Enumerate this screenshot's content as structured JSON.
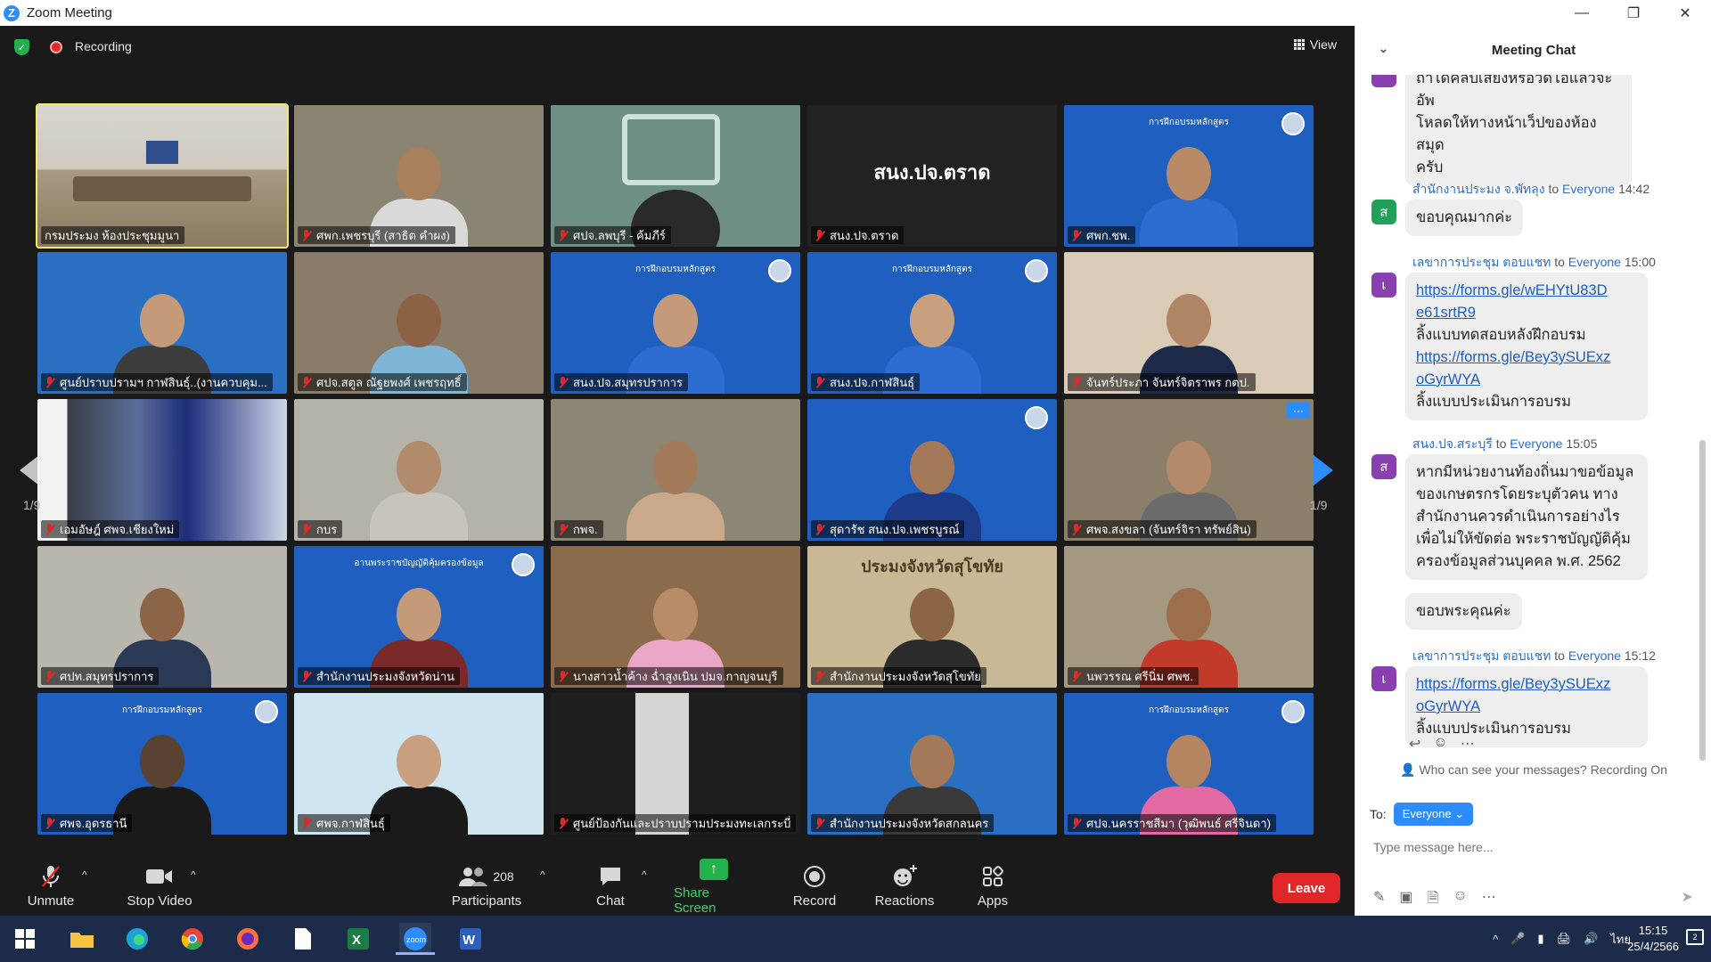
{
  "window": {
    "title": "Zoom Meeting",
    "controls": [
      "—",
      "❐",
      "✕"
    ]
  },
  "top": {
    "recording_label": "Recording",
    "view_label": "View"
  },
  "pagination": {
    "left": "1/9",
    "right": "1/9"
  },
  "tiles": [
    {
      "name": "กรมประมง ห้องประชุมมูนา",
      "muted": false,
      "bg": "#bfb7a5",
      "active": true,
      "kind": "room"
    },
    {
      "name": "ศพก.เพชรบุรี (สาธิต คำผง)",
      "muted": true,
      "bg": "#8a8572",
      "kind": "person",
      "skin": "#a9805c",
      "shirt": "#d9d9d9"
    },
    {
      "name": "ศปจ.ลพบุรี - ค้มภีร์",
      "muted": true,
      "bg": "#6f8e86",
      "kind": "logo"
    },
    {
      "name": "สนง.ปจ.ตราด",
      "muted": true,
      "bg": "#222222",
      "kind": "text",
      "big_text": "สนง.ปจ.ตราด"
    },
    {
      "name": "ศพก.ชพ.",
      "muted": true,
      "bg": "#1f5fbf",
      "kind": "banner",
      "banner": "การฝึกอบรมหลักสูตร",
      "skin": "#b98a66",
      "shirt": "#2d6cd0"
    },
    {
      "name": "ศูนย์ปราบปรามฯ กาฬสินธุ์..(งานควบคุม...",
      "muted": true,
      "bg": "#2a6fc2",
      "kind": "person",
      "skin": "#c59a78",
      "shirt": "#3d3d3d"
    },
    {
      "name": "ศปจ.สตูล ณัฐยพงศ์ เพชรฤทธิ์",
      "muted": true,
      "bg": "#8a7c68",
      "kind": "person",
      "skin": "#8d6244",
      "shirt": "#7fb6d6"
    },
    {
      "name": "สนง.ปจ.สมุทรปราการ",
      "muted": true,
      "bg": "#1f5fbf",
      "kind": "banner",
      "banner": "การฝึกอบรมหลักสูตร",
      "skin": "#c49a7a",
      "shirt": "#2d6cd0"
    },
    {
      "name": "สนง.ปจ.กาฬสินธุ์",
      "muted": true,
      "bg": "#1f5fbf",
      "kind": "banner",
      "banner": "การฝึกอบรมหลักสูตร",
      "skin": "#c8a07e",
      "shirt": "#2d6cd0"
    },
    {
      "name": "จันทร์ประภา จันทร์จิตราพร กตป.",
      "muted": true,
      "bg": "#d9cbb5",
      "kind": "person",
      "skin": "#b08563",
      "shirt": "#1e2a4a"
    },
    {
      "name": "เอมอัษฎ์ ศพจ.เชียงใหม่",
      "muted": true,
      "bg": "#2b3f78",
      "kind": "blur"
    },
    {
      "name": "กบร",
      "muted": true,
      "bg": "#b5b2aa",
      "kind": "person",
      "skin": "#b18b6c",
      "shirt": "#c9c4bb"
    },
    {
      "name": "กพจ.",
      "muted": true,
      "bg": "#8c8676",
      "kind": "person",
      "skin": "#a37a5a",
      "shirt": "#c9a98a"
    },
    {
      "name": "สุดารัช สนง.ปจ.เพชรบูรณ์",
      "muted": true,
      "bg": "#1f5fbf",
      "kind": "banner",
      "banner": "",
      "skin": "#a4795a",
      "shirt": "#1c3b8a"
    },
    {
      "name": "ศพจ.สงขลา (จันทร์จิรา ทรัพย์สิน)",
      "muted": true,
      "bg": "#8c7f6a",
      "kind": "person",
      "skin": "#b38b6a",
      "shirt": "#6b6b6b",
      "more": true
    },
    {
      "name": "ศปท.สมุทรปราการ",
      "muted": true,
      "bg": "#b9b6ae",
      "kind": "person",
      "skin": "#8c6446",
      "shirt": "#2c3a55"
    },
    {
      "name": "สำนักงานประมงจังหวัดน่าน",
      "muted": true,
      "bg": "#1f5fbf",
      "kind": "banner",
      "banner": "อานพระราชบัญญัติคุ้มครองข้อมูล",
      "skin": "#c59a78",
      "shirt": "#7b2a2a"
    },
    {
      "name": "นางสาวน้ำค้าง ฉ่ำสูงเนิน ปมจ.กาญจนบุรี",
      "muted": true,
      "bg": "#8c6a4c",
      "kind": "person",
      "skin": "#b88c68",
      "shirt": "#e9a6c6"
    },
    {
      "name": "สำนักงานประมงจังหวัดสุโขทัย",
      "muted": true,
      "bg": "#c9b895",
      "kind": "person",
      "skin": "#8c6446",
      "shirt": "#2c2c2c",
      "big_text": "ประมงจังหวัดสุโขทัย"
    },
    {
      "name": "นพวรรณ ศรีนิ่ม ศพช.",
      "muted": true,
      "bg": "#a59880",
      "kind": "person",
      "skin": "#9c6e4c",
      "shirt": "#c23a2a"
    },
    {
      "name": "ศพจ.อุดรธานี",
      "muted": true,
      "bg": "#1f5fbf",
      "kind": "banner",
      "banner": "การฝึกอบรมหลักสูตร",
      "skin": "#5a4232",
      "shirt": "#1a1a1a"
    },
    {
      "name": "ศพจ.กาฬสินธุ์",
      "muted": true,
      "bg": "#cfe6f0",
      "kind": "person",
      "skin": "#c8a07e",
      "shirt": "#1a1a1a"
    },
    {
      "name": "ศูนย์ป้องกันและปราบปรามประมงทะเลกระบี่",
      "muted": true,
      "bg": "#1f1f1f",
      "kind": "text",
      "big_text": ""
    },
    {
      "name": "สำนักงานประมงจังหวัดสกลนคร",
      "muted": true,
      "bg": "#2a6fc2",
      "kind": "person",
      "skin": "#a4795a",
      "shirt": "#3a3a3a"
    },
    {
      "name": "ศปจ.นครราชสีมา (วุฒิพนธ์ ศรีจินดา)",
      "muted": true,
      "bg": "#1f5fbf",
      "kind": "banner",
      "banner": "การฝึกอบรมหลักสูตร",
      "skin": "#b48560",
      "shirt": "#e46aa3"
    }
  ],
  "toolbar": {
    "unmute": "Unmute",
    "stop_video": "Stop Video",
    "participants": "Participants",
    "participants_count": "208",
    "chat": "Chat",
    "share_screen": "Share Screen",
    "record": "Record",
    "reactions": "Reactions",
    "apps": "Apps",
    "leave": "Leave"
  },
  "chat": {
    "title": "Meeting Chat",
    "partial_message": [
      "ถ้าได้คลิปเสียงหรือวิดีโอแล้วจะอัพ",
      "โหลดให้ทางหน้าเว็ปของห้องสมุด",
      "ครับ"
    ],
    "messages": [
      {
        "sender": "สำนักงานประมง จ.พัทลุง",
        "to": "to",
        "recipient": "Everyone",
        "time": "14:42",
        "avatar": "ส",
        "avatar_color": "#22a05a",
        "lines": [
          "ขอบคุณมากค่ะ"
        ],
        "links": []
      },
      {
        "sender": "เลขาการประชุม ตอบแชท",
        "to": "to",
        "recipient": "Everyone",
        "time": "15:00",
        "avatar": "เ",
        "avatar_color": "#8a3fb0",
        "lines": [
          "https://forms.gle/wEHYtU83D",
          "e61srtR9",
          "ลิ้งแบบทดสอบหลังฝึกอบรม",
          "https://forms.gle/Bey3ySUExz",
          "oGyrWYA",
          "ลิ้งแบบประเมินการอบรม"
        ]
      },
      {
        "sender": "สนง.ปจ.สระบุรี",
        "to": "to",
        "recipient": "Everyone",
        "time": "15:05",
        "avatar": "ส",
        "avatar_color": "#8a3fb0",
        "lines": [
          "หากมีหน่วยงานท้องถิ่นมาขอข้อมูล",
          "ของเกษตรกรโดยระบุตัวคน ทาง",
          "สำนักงานควรดำเนินการอย่างไร",
          "เพื่อไม่ให้ขัดต่อ พระราชบัญญัติคุ้ม",
          "ครองข้อมูลส่วนบุคคล พ.ศ. 2562"
        ],
        "followup": "ขอบพระคุณค่ะ"
      },
      {
        "sender": "เลขาการประชุม ตอบแชท",
        "to": "to",
        "recipient": "Everyone",
        "time": "15:12",
        "avatar": "เ",
        "avatar_color": "#8a3fb0",
        "lines": [
          "https://forms.gle/Bey3ySUExz",
          "oGyrWYA",
          "ลิ้งแบบประเมินการอบรม"
        ]
      }
    ],
    "visibility_note": "Who can see your messages? Recording On",
    "to_label": "To:",
    "to_value": "Everyone",
    "input_placeholder": "Type message here..."
  },
  "taskbar": {
    "lang": "ไทย",
    "time": "15:15",
    "date": "25/4/2566",
    "notifications": "2"
  }
}
